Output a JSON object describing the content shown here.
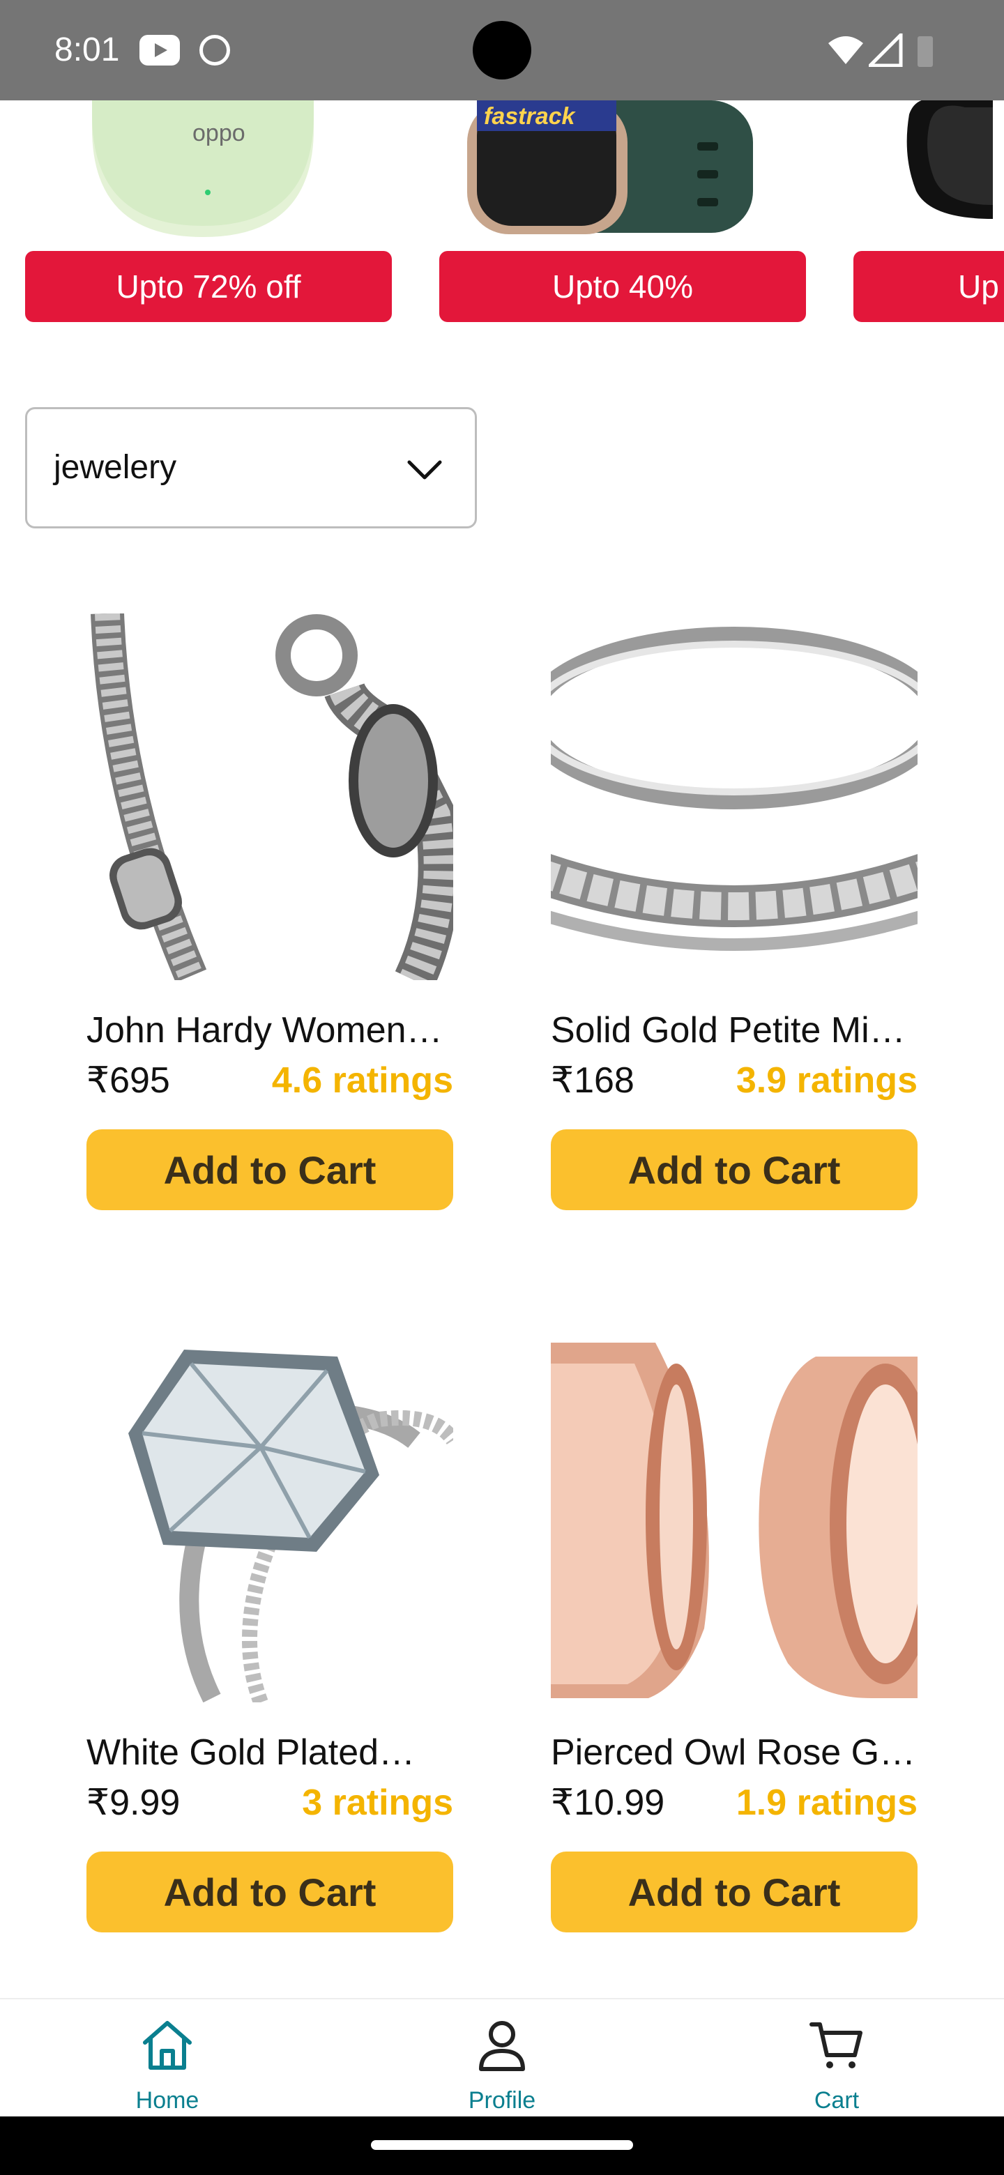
{
  "status_bar": {
    "time": "8:01",
    "icons": [
      "youtube-icon",
      "cat-icon",
      "wifi-icon",
      "signal-icon",
      "battery-icon"
    ]
  },
  "banners": [
    {
      "brand": "oppo",
      "label": "Upto 72% off"
    },
    {
      "brand": "fastrack",
      "label": "Upto 40%"
    },
    {
      "brand": "",
      "label": "Up"
    }
  ],
  "category_dropdown": {
    "selected": "jewelery"
  },
  "products": [
    {
      "name": "John Hardy Women…",
      "price": "₹695",
      "rating": "4.6 ratings",
      "button": "Add to Cart"
    },
    {
      "name": "Solid Gold Petite Mi…",
      "price": "₹168",
      "rating": "3.9 ratings",
      "button": "Add to Cart"
    },
    {
      "name": "White Gold Plated…",
      "price": "₹9.99",
      "rating": "3 ratings",
      "button": "Add to Cart"
    },
    {
      "name": "Pierced Owl Rose G…",
      "price": "₹10.99",
      "rating": "1.9 ratings",
      "button": "Add to Cart"
    }
  ],
  "bottom_nav": {
    "items": [
      {
        "label": "Home",
        "icon": "home-icon"
      },
      {
        "label": "Profile",
        "icon": "profile-icon"
      },
      {
        "label": "Cart",
        "icon": "cart-icon"
      }
    ]
  },
  "colors": {
    "status_bar": "#757575",
    "banner_button": "#e3173a",
    "add_to_cart": "#fbc02d",
    "rating": "#f4b400",
    "nav_accent": "#0a7f8f"
  }
}
